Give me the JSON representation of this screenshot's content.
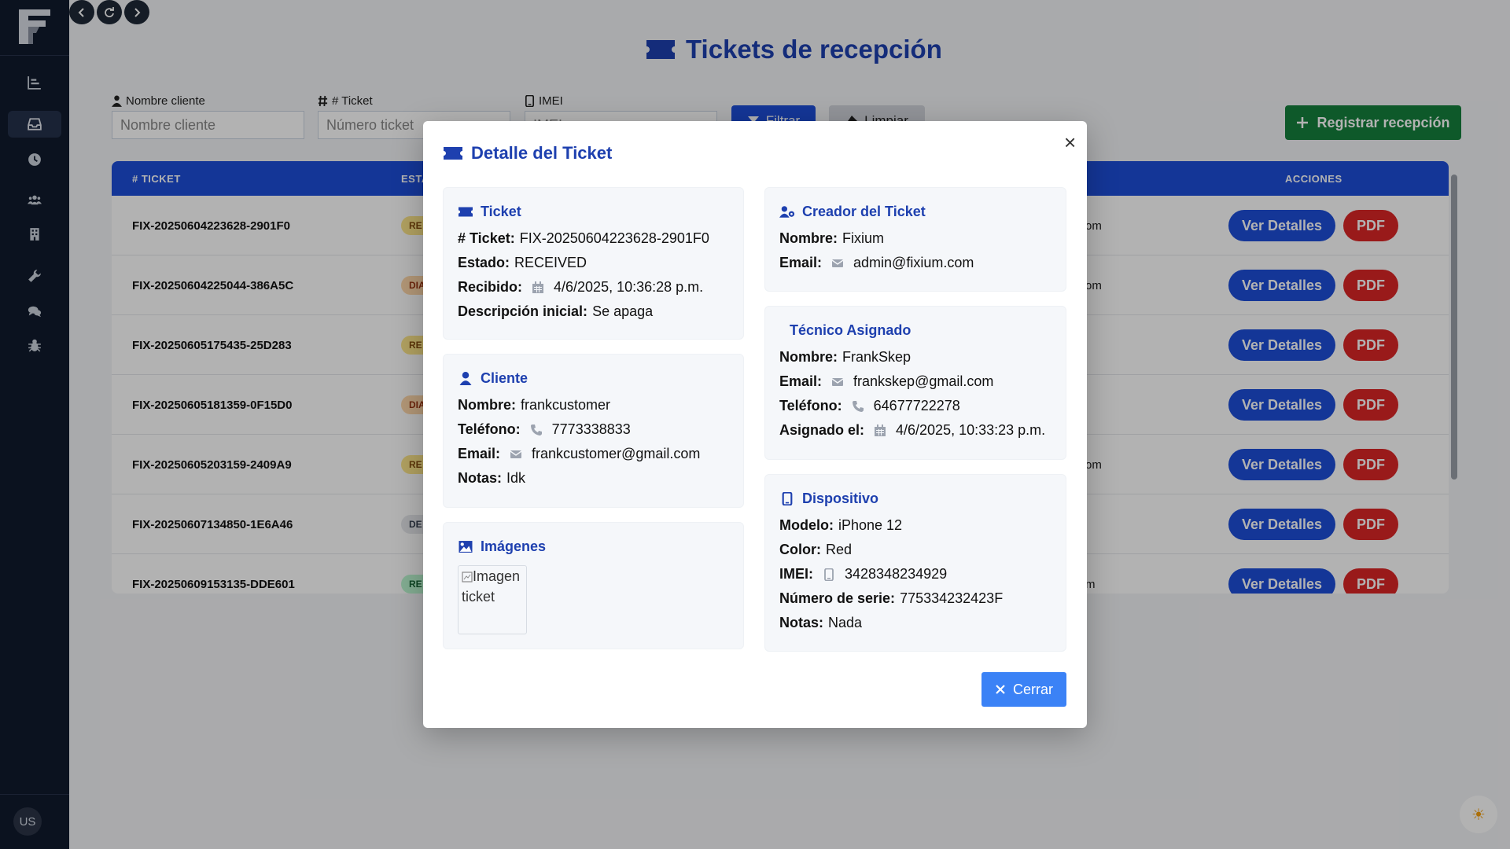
{
  "nav": {
    "back_icon": "chevron-left-icon",
    "reload_icon": "reload-icon",
    "forward_icon": "chevron-right-icon"
  },
  "sidebar": {
    "items": [
      {
        "icon": "chart-icon"
      },
      {
        "icon": "inbox-icon",
        "active": true
      },
      {
        "icon": "clock-icon"
      },
      {
        "icon": "users-icon"
      },
      {
        "icon": "building-icon"
      },
      {
        "icon": "wrench-icon"
      },
      {
        "icon": "chat-icon"
      },
      {
        "icon": "bug-icon"
      }
    ],
    "avatar": "US"
  },
  "page": {
    "title": "Tickets de recepción"
  },
  "filters": {
    "cliente_label": "Nombre cliente",
    "cliente_placeholder": "Nombre cliente",
    "ticket_label": "# Ticket",
    "ticket_placeholder": "Número ticket",
    "imei_label": "IMEI",
    "imei_placeholder": "IMEI",
    "filtrar": "Filtrar",
    "limpiar": "Limpiar",
    "registrar": "Registrar recepción"
  },
  "table": {
    "headers": {
      "ticket": "# TICKET",
      "estado": "ESTADO",
      "acciones": "ACCIONES"
    },
    "ver_label": "Ver Detalles",
    "pdf_label": "PDF",
    "rows": [
      {
        "ticket": "FIX-20250604223628-2901F0",
        "badge": "RE",
        "email_tail": "om"
      },
      {
        "ticket": "FIX-20250604225044-386A5C",
        "badge": "DIA",
        "email_tail": "om"
      },
      {
        "ticket": "FIX-20250605175435-25D283",
        "badge": "RE",
        "email_tail": ""
      },
      {
        "ticket": "FIX-20250605181359-0F15D0",
        "badge": "DIA",
        "email_tail": ""
      },
      {
        "ticket": "FIX-20250605203159-2409A9",
        "badge": "RE",
        "email_tail": "om"
      },
      {
        "ticket": "FIX-20250607134850-1E6A46",
        "badge": "DE",
        "email_tail": ""
      },
      {
        "ticket": "FIX-20250609153135-DDE601",
        "badge": "RE",
        "email_tail": "m"
      }
    ]
  },
  "modal": {
    "title": "Detalle del Ticket",
    "ticket": {
      "header": "Ticket",
      "numero_label": "# Ticket:",
      "numero": "FIX-20250604223628-2901F0",
      "estado_label": "Estado:",
      "estado": "RECEIVED",
      "recibido_label": "Recibido:",
      "recibido": "4/6/2025, 10:36:28 p.m.",
      "desc_label": "Descripción inicial:",
      "desc": "Se apaga"
    },
    "cliente": {
      "header": "Cliente",
      "nombre_label": "Nombre:",
      "nombre": "frankcustomer",
      "telefono_label": "Teléfono:",
      "telefono": "7773338833",
      "email_label": "Email:",
      "email": "frankcustomer@gmail.com",
      "notas_label": "Notas:",
      "notas": "Idk"
    },
    "imagenes": {
      "header": "Imágenes",
      "alt": "Imagen ticket"
    },
    "creador": {
      "header": "Creador del Ticket",
      "nombre_label": "Nombre:",
      "nombre": "Fixium",
      "email_label": "Email:",
      "email": "admin@fixium.com"
    },
    "tecnico": {
      "header": "Técnico Asignado",
      "nombre_label": "Nombre:",
      "nombre": "FrankSkep",
      "email_label": "Email:",
      "email": "frankskep@gmail.com",
      "telefono_label": "Teléfono:",
      "telefono": "64677722278",
      "asignado_label": "Asignado el:",
      "asignado": "4/6/2025, 10:33:23 p.m."
    },
    "dispositivo": {
      "header": "Dispositivo",
      "modelo_label": "Modelo:",
      "modelo": "iPhone 12",
      "color_label": "Color:",
      "color": "Red",
      "imei_label": "IMEI:",
      "imei": "3428348234929",
      "serie_label": "Número de serie:",
      "serie": "775334232423F",
      "notas_label": "Notas:",
      "notas": "Nada"
    },
    "cerrar": "Cerrar",
    "close_glyph": "×"
  },
  "colors": {
    "primary": "#1d4ed8",
    "title": "#1e40af",
    "success": "#15803d",
    "danger": "#dc2626",
    "sidebar": "#111b2d"
  }
}
